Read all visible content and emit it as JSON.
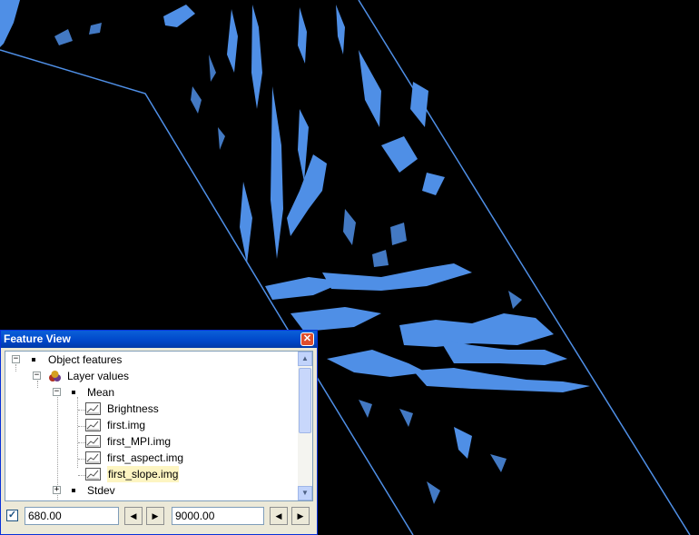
{
  "window": {
    "title": "Feature View",
    "close_glyph": "✕"
  },
  "tree": {
    "object_features": "Object features",
    "layer_values": "Layer values",
    "mean": "Mean",
    "features": [
      "Brightness",
      "first.img",
      "first_MPI.img",
      "first_aspect.img",
      "first_slope.img"
    ],
    "selected_feature": "first_slope.img",
    "stdev": "Stdev"
  },
  "range": {
    "checkbox_checked": true,
    "min_value": "680.00",
    "max_value": "9000.00"
  },
  "colors": {
    "feature_fill": "#4f8fe6",
    "background": "#000000",
    "title_bar": "#0047c9"
  }
}
